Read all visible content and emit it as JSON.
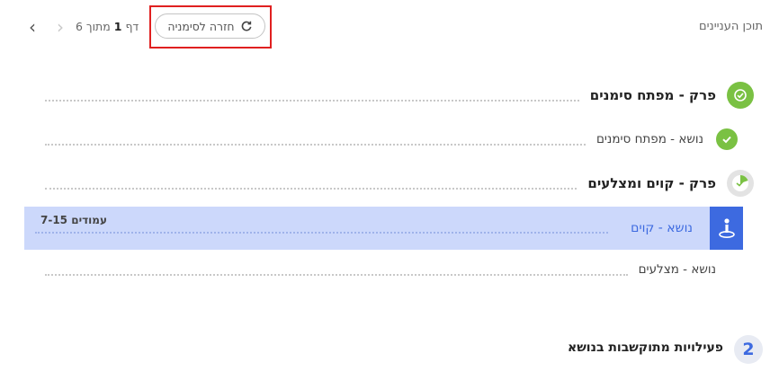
{
  "header": {
    "toc_title": "תוכן העניינים",
    "back_to_bookmark": "חזרה לסימניה",
    "page_prefix": "דף",
    "page_current": "1",
    "page_of": "מתוך 6",
    "prev_icon": "chevron-left-icon",
    "next_icon": "chevron-right-icon"
  },
  "toc": {
    "chapters": [
      {
        "label": "פרק - מפתח סימנים",
        "status": "complete",
        "topics": [
          {
            "label": "נושא - מפתח סימנים",
            "status": "complete"
          }
        ]
      },
      {
        "label": "פרק - קוים ומצלעים",
        "status": "partial",
        "topics": [
          {
            "label": "נושא - קוים",
            "status": "active",
            "pages": "עמודים 7-15"
          },
          {
            "label": "נושא - מצלעים",
            "status": "none"
          }
        ]
      }
    ]
  },
  "related": {
    "number": "2",
    "title": "פעילויות מתוקשבות בנושא"
  },
  "colors": {
    "complete": "#7ac143",
    "active": "#3d6ae0",
    "active_bg": "#ccd8fb",
    "highlight": "#e02020"
  }
}
